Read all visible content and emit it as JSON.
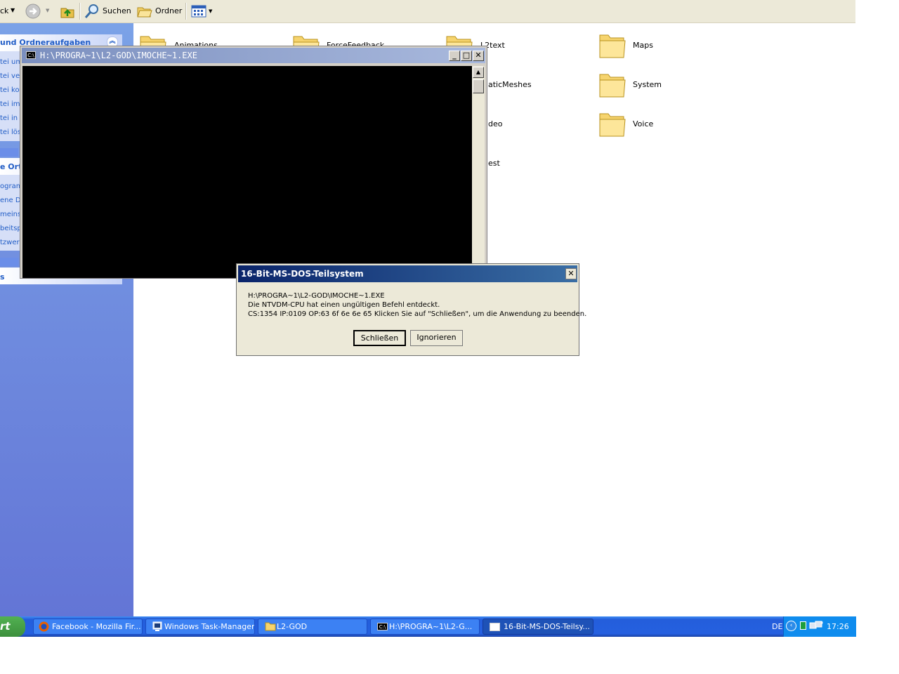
{
  "toolbar": {
    "back_label": "ck",
    "search_label": "Suchen",
    "folders_label": "Ordner"
  },
  "left_pane": {
    "section1_title": "und Ordneraufgaben",
    "section1_links": [
      "tei um",
      "tei ve",
      "tei ko",
      "tei im",
      "tei in",
      "tei lös"
    ],
    "section2_title": "e Ort",
    "section2_links": [
      "ogram",
      "ene D",
      "meins",
      "beitsp",
      "tzwer"
    ],
    "section3_title": "s"
  },
  "folders": [
    "Animations",
    "ForceFeedback",
    "L2text",
    "Maps",
    "aticMeshes",
    "System",
    "deo",
    "Voice",
    "est"
  ],
  "console": {
    "title": "H:\\PROGRA~1\\L2-GOD\\IMOCHE~1.EXE"
  },
  "dialog": {
    "title": "16-Bit-MS-DOS-Teilsystem",
    "line1": "H:\\PROGRA~1\\L2-GOD\\IMOCHE~1.EXE",
    "line2": "Die NTVDM-CPU hat einen ungültigen Befehl entdeckt.",
    "line3": "CS:1354 IP:0109 OP:63 6f 6e 6e 65 Klicken Sie auf \"Schließen\", um die Anwendung zu beenden.",
    "close_button": "Schließen",
    "ignore_button": "Ignorieren"
  },
  "taskbar": {
    "start_label": "rt",
    "tasks": [
      {
        "label": "Facebook - Mozilla Fir..."
      },
      {
        "label": "Windows Task-Manager"
      },
      {
        "label": "L2-GOD"
      },
      {
        "label": "H:\\PROGRA~1\\L2-G..."
      },
      {
        "label": "16-Bit-MS-DOS-Teilsy..."
      }
    ],
    "language": "DE",
    "clock": "17:26"
  },
  "colors": {
    "title_active": "#0a246a",
    "taskbar": "#245edb",
    "start": "#3c8f3c"
  }
}
